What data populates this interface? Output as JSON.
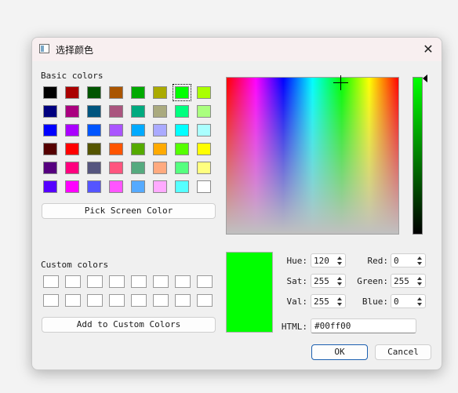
{
  "window": {
    "title": "选择颜色",
    "close_glyph": "✕"
  },
  "basic_colors": {
    "label": "Basic colors",
    "swatches": [
      "#000000",
      "#aa0000",
      "#005500",
      "#aa5500",
      "#00aa00",
      "#aaaa00",
      "#00ff00",
      "#aaff00",
      "#00007f",
      "#aa007f",
      "#00557f",
      "#aa557f",
      "#00aa7f",
      "#aaaa7f",
      "#00ff7f",
      "#aaff7f",
      "#0000ff",
      "#aa00ff",
      "#0055ff",
      "#aa55ff",
      "#00aaff",
      "#aaaaff",
      "#00ffff",
      "#aaffff",
      "#550000",
      "#ff0000",
      "#555500",
      "#ff5500",
      "#55aa00",
      "#ffaa00",
      "#55ff00",
      "#ffff00",
      "#55007f",
      "#ff007f",
      "#55557f",
      "#ff557f",
      "#55aa7f",
      "#ffaa7f",
      "#55ff7f",
      "#ffff7f",
      "#5500ff",
      "#ff00ff",
      "#5555ff",
      "#ff55ff",
      "#55aaff",
      "#ffaaff",
      "#55ffff",
      "#ffffff"
    ],
    "selected_index": 6
  },
  "pick_screen_button": "Pick Screen Color",
  "custom_colors": {
    "label": "Custom colors",
    "count": 16
  },
  "add_custom_button": "Add to Custom Colors",
  "fields": {
    "hue": {
      "label": "Hue:",
      "value": "120"
    },
    "sat": {
      "label": "Sat:",
      "value": "255"
    },
    "val": {
      "label": "Val:",
      "value": "255"
    },
    "red": {
      "label": "Red:",
      "value": "0"
    },
    "green": {
      "label": "Green:",
      "value": "255"
    },
    "blue": {
      "label": "Blue:",
      "value": "0"
    },
    "html": {
      "label": "HTML:",
      "value": "#00ff00"
    }
  },
  "current_color": "#00ff00",
  "buttons": {
    "ok": "OK",
    "cancel": "Cancel"
  }
}
